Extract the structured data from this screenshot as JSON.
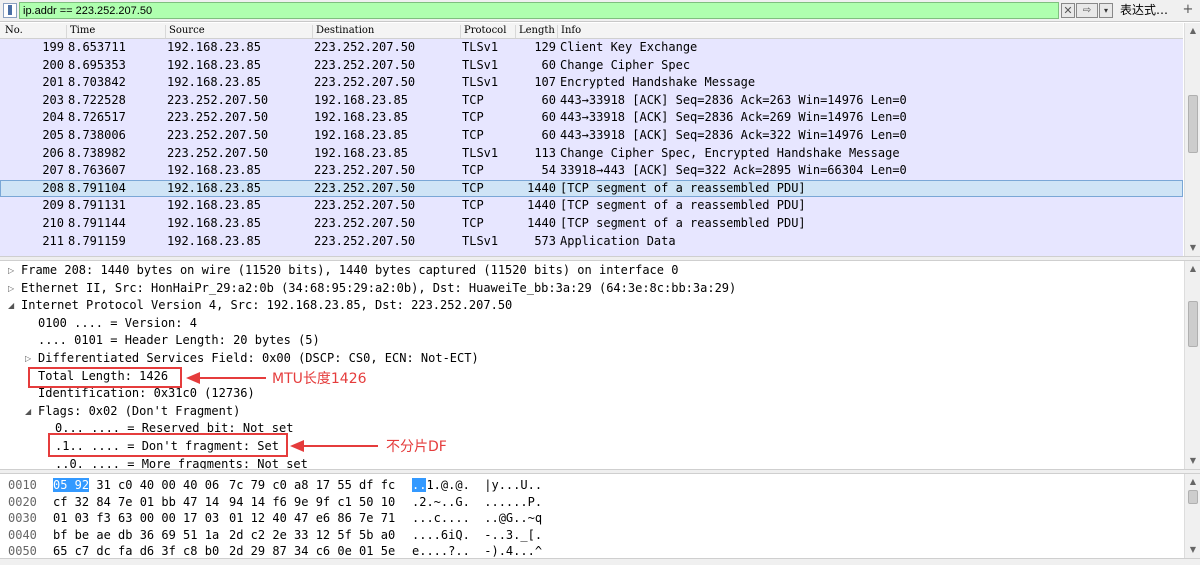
{
  "filter": {
    "value": "ip.addr == 223.252.207.50",
    "clear_icon": "✕",
    "apply_icon": "⇨",
    "dropdown_icon": "▾",
    "expression_label": "表达式…",
    "plus_label": "+"
  },
  "columns": [
    "No.",
    "Time",
    "Source",
    "Destination",
    "Protocol",
    "Length",
    "Info"
  ],
  "packets": [
    {
      "no": "199",
      "time": "8.653711",
      "src": "192.168.23.85",
      "dst": "223.252.207.50",
      "proto": "TLSv1",
      "len": "129",
      "info": "Client Key Exchange"
    },
    {
      "no": "200",
      "time": "8.695353",
      "src": "192.168.23.85",
      "dst": "223.252.207.50",
      "proto": "TLSv1",
      "len": "60",
      "info": "Change Cipher Spec"
    },
    {
      "no": "201",
      "time": "8.703842",
      "src": "192.168.23.85",
      "dst": "223.252.207.50",
      "proto": "TLSv1",
      "len": "107",
      "info": "Encrypted Handshake Message"
    },
    {
      "no": "203",
      "time": "8.722528",
      "src": "223.252.207.50",
      "dst": "192.168.23.85",
      "proto": "TCP",
      "len": "60",
      "info": "443→33918 [ACK] Seq=2836 Ack=263 Win=14976 Len=0"
    },
    {
      "no": "204",
      "time": "8.726517",
      "src": "223.252.207.50",
      "dst": "192.168.23.85",
      "proto": "TCP",
      "len": "60",
      "info": "443→33918 [ACK] Seq=2836 Ack=269 Win=14976 Len=0"
    },
    {
      "no": "205",
      "time": "8.738006",
      "src": "223.252.207.50",
      "dst": "192.168.23.85",
      "proto": "TCP",
      "len": "60",
      "info": "443→33918 [ACK] Seq=2836 Ack=322 Win=14976 Len=0"
    },
    {
      "no": "206",
      "time": "8.738982",
      "src": "223.252.207.50",
      "dst": "192.168.23.85",
      "proto": "TLSv1",
      "len": "113",
      "info": "Change Cipher Spec, Encrypted Handshake Message"
    },
    {
      "no": "207",
      "time": "8.763607",
      "src": "192.168.23.85",
      "dst": "223.252.207.50",
      "proto": "TCP",
      "len": "54",
      "info": "33918→443 [ACK] Seq=322 Ack=2895 Win=66304 Len=0"
    },
    {
      "no": "208",
      "time": "8.791104",
      "src": "192.168.23.85",
      "dst": "223.252.207.50",
      "proto": "TCP",
      "len": "1440",
      "info": "[TCP segment of a reassembled PDU]",
      "selected": true
    },
    {
      "no": "209",
      "time": "8.791131",
      "src": "192.168.23.85",
      "dst": "223.252.207.50",
      "proto": "TCP",
      "len": "1440",
      "info": "[TCP segment of a reassembled PDU]"
    },
    {
      "no": "210",
      "time": "8.791144",
      "src": "192.168.23.85",
      "dst": "223.252.207.50",
      "proto": "TCP",
      "len": "1440",
      "info": "[TCP segment of a reassembled PDU]"
    },
    {
      "no": "211",
      "time": "8.791159",
      "src": "192.168.23.85",
      "dst": "223.252.207.50",
      "proto": "TLSv1",
      "len": "573",
      "info": "Application Data"
    }
  ],
  "details": [
    {
      "indent": 0,
      "twisty": "▷",
      "text": "Frame 208: 1440 bytes on wire (11520 bits), 1440 bytes captured (11520 bits) on interface 0"
    },
    {
      "indent": 0,
      "twisty": "▷",
      "text": "Ethernet II, Src: HonHaiPr_29:a2:0b (34:68:95:29:a2:0b), Dst: HuaweiTe_bb:3a:29 (64:3e:8c:bb:3a:29)"
    },
    {
      "indent": 0,
      "twisty": "◢",
      "text": "Internet Protocol Version 4, Src: 192.168.23.85, Dst: 223.252.207.50"
    },
    {
      "indent": 1,
      "twisty": "",
      "text": "0100 .... = Version: 4"
    },
    {
      "indent": 1,
      "twisty": "",
      "text": ".... 0101 = Header Length: 20 bytes (5)"
    },
    {
      "indent": 1,
      "twisty": "▷",
      "text": "Differentiated Services Field: 0x00 (DSCP: CS0, ECN: Not-ECT)"
    },
    {
      "indent": 1,
      "twisty": "",
      "text": "Total Length: 1426"
    },
    {
      "indent": 1,
      "twisty": "",
      "text": "Identification: 0x31c0 (12736)"
    },
    {
      "indent": 1,
      "twisty": "◢",
      "text": "Flags: 0x02 (Don't Fragment)"
    },
    {
      "indent": 2,
      "twisty": "",
      "text": "0... .... = Reserved bit: Not set"
    },
    {
      "indent": 2,
      "twisty": "",
      "text": ".1.. .... = Don't fragment: Set"
    },
    {
      "indent": 2,
      "twisty": "",
      "text": "..0. .... = More fragments: Not set"
    }
  ],
  "annotations": {
    "mtu": "MTU长度1426",
    "df": "不分片DF"
  },
  "bytes": [
    {
      "off": "0010",
      "hex_sel": "05 92",
      "hex1": " 31 c0 40 00 40 06",
      "hex2": "7c 79 c0 a8 17 55 df fc",
      "asc_sel": "..",
      "asc": "1.@.@.  |y...U.."
    },
    {
      "off": "0020",
      "hex_sel": "",
      "hex1": "cf 32 84 7e 01 bb 47 14",
      "hex2": "94 14 f6 9e 9f c1 50 10",
      "asc_sel": "",
      "asc": ".2.~..G.  ......P."
    },
    {
      "off": "0030",
      "hex_sel": "",
      "hex1": "01 03 f3 63 00 00 17 03",
      "hex2": "01 12 40 47 e6 86 7e 71",
      "asc_sel": "",
      "asc": "...c....  ..@G..~q"
    },
    {
      "off": "0040",
      "hex_sel": "",
      "hex1": "bf be ae db 36 69 51 1a",
      "hex2": "2d c2 2e 33 12 5f 5b a0",
      "asc_sel": "",
      "asc": "....6iQ.  -..3._[."
    },
    {
      "off": "0050",
      "hex_sel": "",
      "hex1": "65 c7 dc fa d6 3f c8 b0",
      "hex2": "2d 29 87 34 c6 0e 01 5e",
      "asc_sel": "",
      "asc": "e....?..  -).4...^"
    }
  ]
}
